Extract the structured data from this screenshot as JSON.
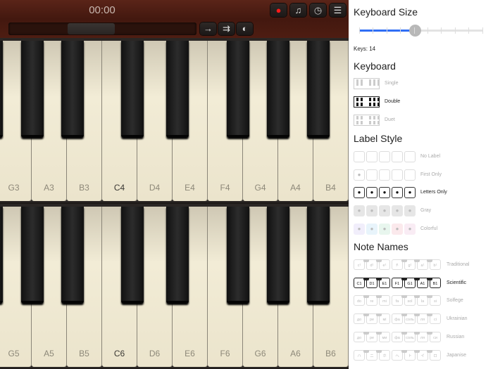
{
  "toolbar": {
    "timer": "00:00",
    "buttons": [
      {
        "name": "record-button",
        "icon": "record-icon",
        "glyph": "●",
        "color": "#ff1a1a"
      },
      {
        "name": "music-button",
        "icon": "music-note-icon",
        "glyph": "♫",
        "color": "#dddddd"
      },
      {
        "name": "metronome-button",
        "icon": "clock-icon",
        "glyph": "◷",
        "color": "#cccccc"
      },
      {
        "name": "menu-button",
        "icon": "menu-icon",
        "glyph": "☰",
        "color": "#dddddd"
      }
    ],
    "track_buttons": [
      {
        "name": "step-forward-button",
        "icon": "arrow-right-icon",
        "glyph": "→"
      },
      {
        "name": "fast-forward-button",
        "icon": "double-arrow-icon",
        "glyph": "⇉"
      },
      {
        "name": "split-button",
        "icon": "split-icon",
        "glyph": "◐"
      }
    ]
  },
  "keyboards": [
    {
      "white": [
        "G3",
        "A3",
        "B3",
        "C4",
        "D4",
        "E4",
        "F4",
        "G4",
        "A4",
        "B4"
      ],
      "highlight": "C4"
    },
    {
      "white": [
        "G5",
        "A5",
        "B5",
        "C6",
        "D6",
        "E6",
        "F6",
        "G6",
        "A6",
        "B6"
      ],
      "highlight": "C6"
    }
  ],
  "panel": {
    "size_title": "Keyboard Size",
    "slider_value": 0.45,
    "keys_label": "Keys: 14",
    "keyboard_title": "Keyboard",
    "keyboard_options": [
      {
        "label": "Single",
        "selected": false
      },
      {
        "label": "Double",
        "selected": true
      },
      {
        "label": "Duet",
        "selected": false
      }
    ],
    "label_title": "Label Style",
    "label_options": [
      {
        "label": "No Label",
        "selected": false
      },
      {
        "label": "First Only",
        "selected": false
      },
      {
        "label": "Letters Only",
        "selected": true
      },
      {
        "label": "Gray",
        "selected": false
      },
      {
        "label": "Colorful",
        "selected": false
      }
    ],
    "colorful_colors": [
      "#f1eefb",
      "#e8f4fb",
      "#e8f6ee",
      "#fbe9ec",
      "#f9ecf4"
    ],
    "names_title": "Note Names",
    "name_options": [
      {
        "label": "Traditional",
        "selected": false,
        "notes": [
          "c¹",
          "d¹",
          "e¹",
          "f¹",
          "g¹",
          "a¹",
          "b¹"
        ]
      },
      {
        "label": "Scientific",
        "selected": true,
        "notes": [
          "C1",
          "D1",
          "E1",
          "F1",
          "G1",
          "A1",
          "B1"
        ]
      },
      {
        "label": "Solfege",
        "selected": false,
        "notes": [
          "do",
          "re",
          "mi",
          "fa",
          "sol",
          "la",
          "si"
        ]
      },
      {
        "label": "Ukrainian",
        "selected": false,
        "notes": [
          "до",
          "ре",
          "мі",
          "фа",
          "соль",
          "ля",
          "сі"
        ]
      },
      {
        "label": "Russian",
        "selected": false,
        "notes": [
          "до",
          "ре",
          "ми",
          "фа",
          "соль",
          "ля",
          "си"
        ]
      },
      {
        "label": "Japanise",
        "selected": false,
        "notes": [
          "ハ",
          "ニ",
          "ホ",
          "ヘ",
          "ト",
          "イ",
          "ロ"
        ]
      }
    ]
  }
}
